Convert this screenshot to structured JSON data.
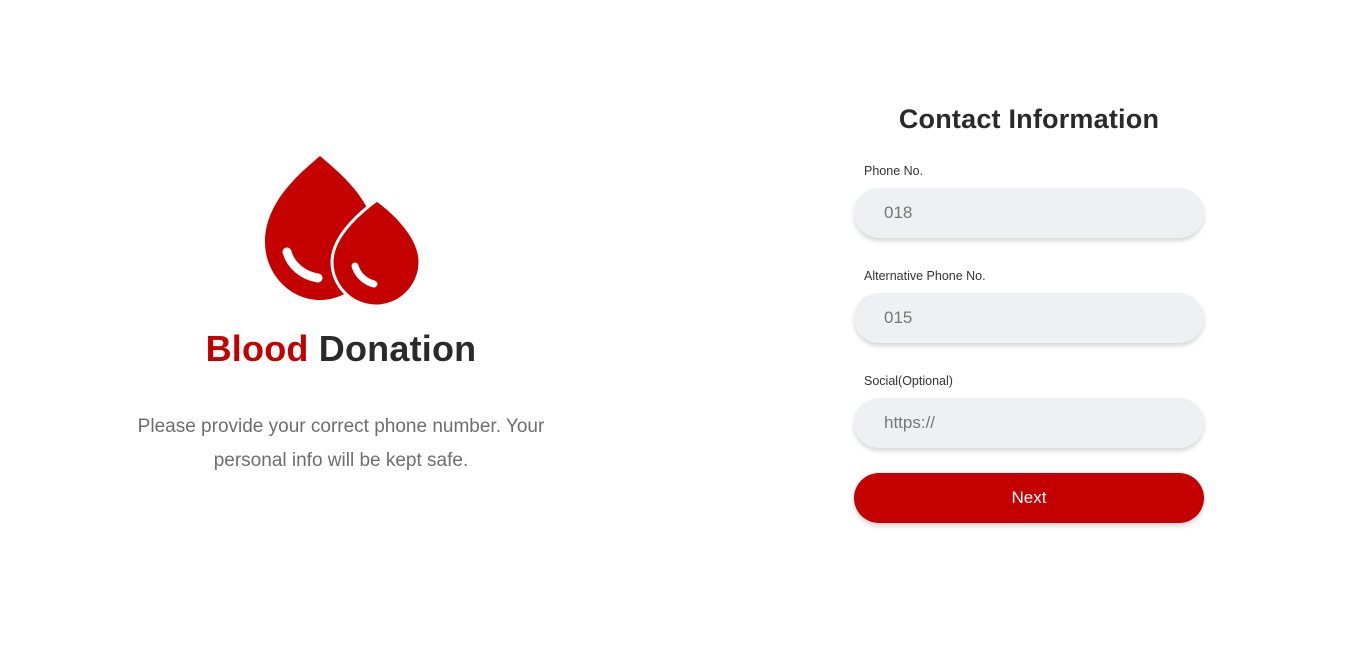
{
  "brand": {
    "title_accent": "Blood",
    "title_rest": " Donation",
    "description": "Please provide your correct phone number. Your personal info will be kept safe.",
    "logo_icon": "blood-drops-icon",
    "accent_color": "#c40000"
  },
  "form": {
    "title": "Contact Information",
    "fields": [
      {
        "label": "Phone No.",
        "placeholder": "018",
        "value": ""
      },
      {
        "label": "Alternative Phone No.",
        "placeholder": "015",
        "value": ""
      },
      {
        "label": "Social(Optional)",
        "placeholder": "https://",
        "value": ""
      }
    ],
    "next_label": "Next"
  }
}
